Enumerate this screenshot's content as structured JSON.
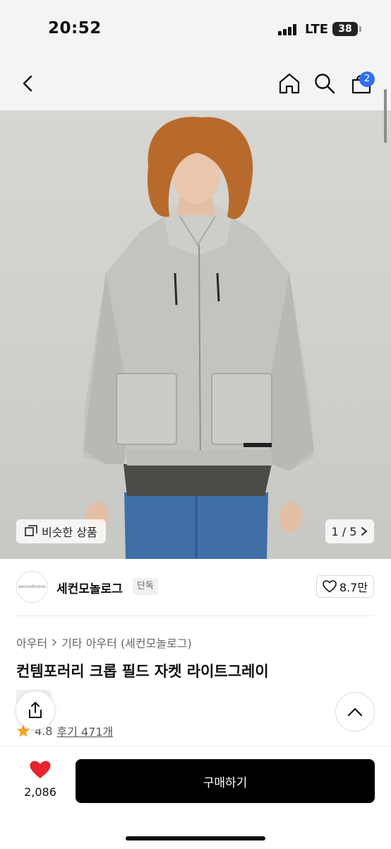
{
  "status": {
    "time": "20:52",
    "network": "LTE",
    "battery": "38"
  },
  "nav": {
    "cart_count": "2"
  },
  "gallery": {
    "similar_label": "비슷한 상품",
    "page_indicator": "1 / 5"
  },
  "brand": {
    "logo_text": "secondmono",
    "name": "세컨모놀로그",
    "tag": "단독",
    "likes": "8.7만"
  },
  "breadcrumb": {
    "level1": "아우터",
    "level2": "기타 아우터 (세컨모놀로그)"
  },
  "product": {
    "title": "컨템포러리 크롭 필드 자켓 라이트그레이",
    "rating": "4.8",
    "reviews": "후기 471개"
  },
  "bottom": {
    "wish_count": "2,086",
    "buy_label": "구매하기"
  },
  "colors": {
    "accent": "#2f6ff0",
    "wish_red": "#e8232d",
    "star": "#f5a623"
  }
}
